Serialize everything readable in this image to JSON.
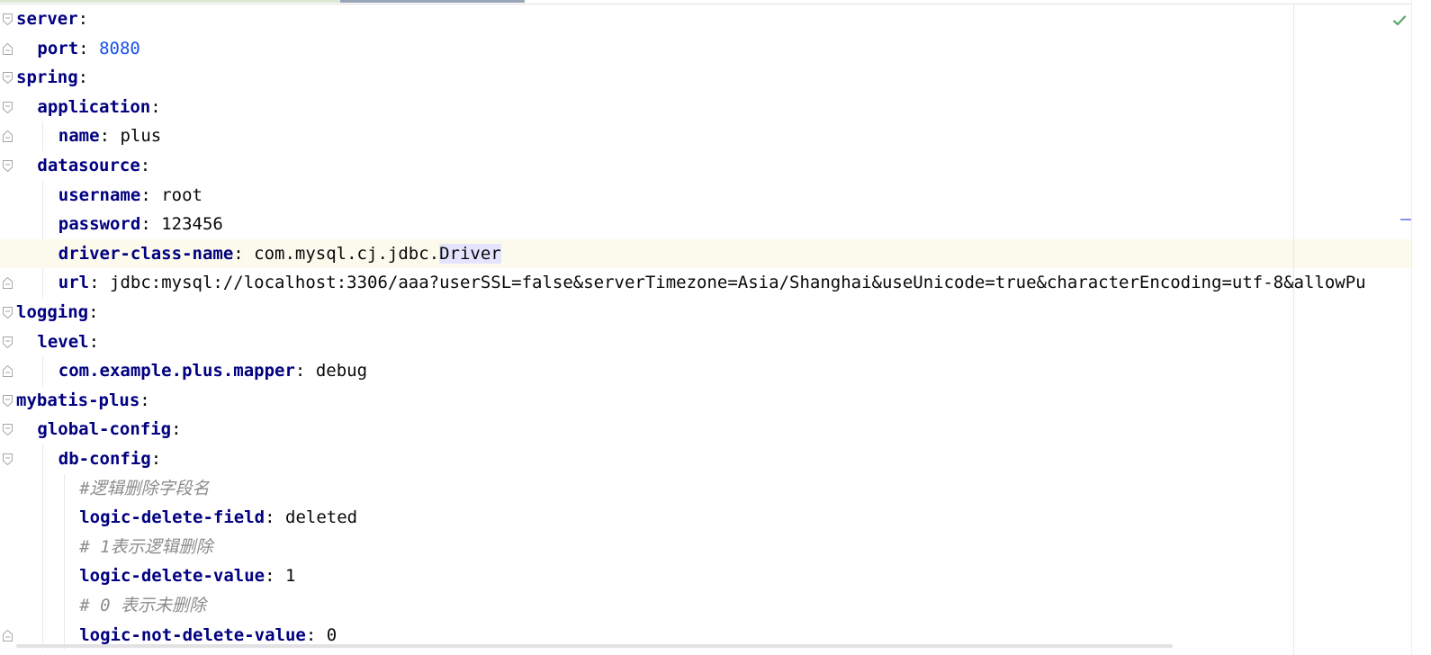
{
  "editor": {
    "language": "yaml",
    "lines": [
      {
        "indent": 0,
        "key": "server",
        "value": "",
        "value_type": "",
        "fold": "open"
      },
      {
        "indent": 1,
        "key": "port",
        "value": "8080",
        "value_type": "number",
        "fold": "close"
      },
      {
        "indent": 0,
        "key": "spring",
        "value": "",
        "value_type": "",
        "fold": "open"
      },
      {
        "indent": 1,
        "key": "application",
        "value": "",
        "value_type": "",
        "fold": "open"
      },
      {
        "indent": 2,
        "key": "name",
        "value": "plus",
        "value_type": "string",
        "fold": "close"
      },
      {
        "indent": 1,
        "key": "datasource",
        "value": "",
        "value_type": "",
        "fold": "open"
      },
      {
        "indent": 2,
        "key": "username",
        "value": "root",
        "value_type": "string",
        "fold": ""
      },
      {
        "indent": 2,
        "key": "password",
        "value": "123456",
        "value_type": "string",
        "fold": ""
      },
      {
        "indent": 2,
        "key": "driver-class-name",
        "value_pre": "com.mysql.cj.jdbc.",
        "value_hl": "Driver",
        "value": "com.mysql.cj.jdbc.Driver",
        "value_type": "string",
        "fold": "",
        "current": true
      },
      {
        "indent": 2,
        "key": "url",
        "value": "jdbc:mysql://localhost:3306/aaa?userSSL=false&serverTimezone=Asia/Shanghai&useUnicode=true&characterEncoding=utf-8&allowPu",
        "value_type": "string",
        "fold": "close"
      },
      {
        "indent": 0,
        "key": "logging",
        "value": "",
        "value_type": "",
        "fold": "open"
      },
      {
        "indent": 1,
        "key": "level",
        "value": "",
        "value_type": "",
        "fold": "open"
      },
      {
        "indent": 2,
        "key": "com.example.plus.mapper",
        "value": "debug",
        "value_type": "string",
        "fold": "close"
      },
      {
        "indent": 0,
        "key": "mybatis-plus",
        "value": "",
        "value_type": "",
        "fold": "open"
      },
      {
        "indent": 1,
        "key": "global-config",
        "value": "",
        "value_type": "",
        "fold": "open"
      },
      {
        "indent": 2,
        "key": "db-config",
        "value": "",
        "value_type": "",
        "fold": "open"
      },
      {
        "indent": 3,
        "comment": "#逻辑删除字段名",
        "fold": ""
      },
      {
        "indent": 3,
        "key": "logic-delete-field",
        "value": "deleted",
        "value_type": "string",
        "fold": ""
      },
      {
        "indent": 3,
        "comment": "# 1表示逻辑删除",
        "fold": ""
      },
      {
        "indent": 3,
        "key": "logic-delete-value",
        "value": "1",
        "value_type": "string",
        "fold": ""
      },
      {
        "indent": 3,
        "comment": "# 0 表示未删除",
        "fold": ""
      },
      {
        "indent": 3,
        "key": "logic-not-delete-value",
        "value": "0",
        "value_type": "string",
        "fold": "close"
      }
    ]
  },
  "status": {
    "inspection_icon": "check-icon",
    "inspection_color": "#59a869"
  },
  "colors": {
    "key": "#000080",
    "number": "#1750eb",
    "comment": "#8c8c8c",
    "current_line": "#fcfaed",
    "highlight": "#e4e4ff"
  }
}
